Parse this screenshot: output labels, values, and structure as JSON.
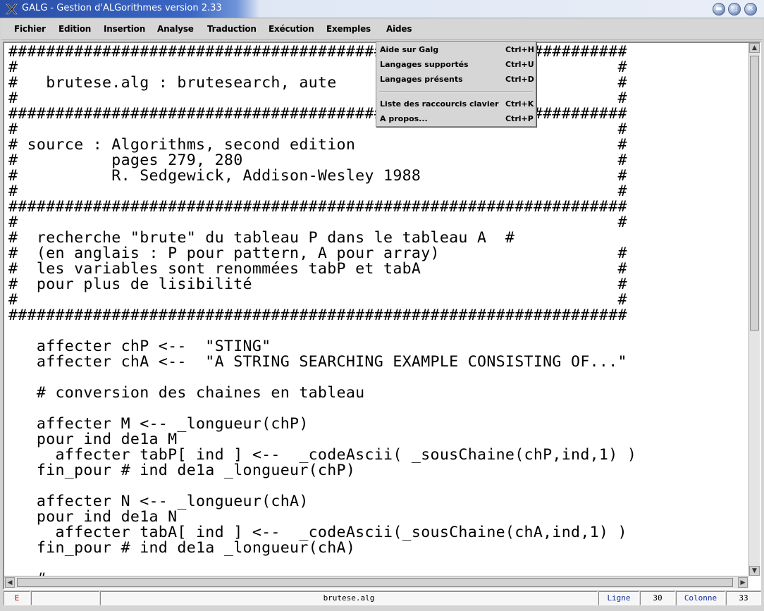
{
  "window": {
    "title": "GALG - Gestion d'ALGorithmes version 2.33",
    "icon": "x-app-icon",
    "buttons": [
      "minimize",
      "maximize",
      "close"
    ]
  },
  "menubar": {
    "items": [
      {
        "label": "Fichier"
      },
      {
        "label": "Edition"
      },
      {
        "label": "Insertion"
      },
      {
        "label": "Analyse"
      },
      {
        "label": "Traduction"
      },
      {
        "label": "Exécution"
      },
      {
        "label": "Exemples"
      },
      {
        "label": "Aides"
      }
    ]
  },
  "dropdown": {
    "menu": "Aides",
    "items": [
      {
        "label": "Aide sur Galg",
        "shortcut": "Ctrl+H"
      },
      {
        "label": "Langages supportés",
        "shortcut": "Ctrl+U"
      },
      {
        "label": "Langages présents",
        "shortcut": "Ctrl+D"
      },
      {
        "label": "Liste des raccourcis clavier",
        "shortcut": "Ctrl+K"
      },
      {
        "label": "A propos...",
        "shortcut": "Ctrl+P"
      }
    ]
  },
  "editor": {
    "lines": [
      "##################################################################",
      "#                                                                #",
      "#   brutese.alg : brutesearch, aute                              #",
      "#                                                                #",
      "##################################################################",
      "#                                                                #",
      "# source : Algorithms, second edition                            #",
      "#          pages 279, 280                                        #",
      "#          R. Sedgewick, Addison-Wesley 1988                     #",
      "#                                                                #",
      "##################################################################",
      "#                                                                #",
      "#  recherche \"brute\" du tableau P dans le tableau A  #",
      "#  (en anglais : P pour pattern, A pour array)                   #",
      "#  les variables sont renommées tabP et tabA                     #",
      "#  pour plus de lisibilité                                       #",
      "#                                                                #",
      "##################################################################",
      "",
      "   affecter chP <--  \"STING\"",
      "   affecter chA <--  \"A STRING SEARCHING EXAMPLE CONSISTING OF...\"",
      "",
      "   # conversion des chaines en tableau",
      "",
      "   affecter M <-- _longueur(chP)",
      "   pour ind de1a M",
      "     affecter tabP[ ind ] <--  _codeAscii( _sousChaine(chP,ind,1) )",
      "   fin_pour # ind de1a _longueur(chP)",
      "",
      "   affecter N <-- _longueur(chA)",
      "   pour ind de1a N",
      "     affecter tabA[ ind ] <--  _codeAscii(_sousChaine(chA,ind,1) )",
      "   fin_pour # ind de1a _longueur(chA)",
      "",
      "   # "
    ]
  },
  "statusbar": {
    "mode": "E",
    "empty": "",
    "filename": "brutese.alg",
    "line_label": "Ligne",
    "line_value": "30",
    "col_label": "Colonne",
    "col_value": "33"
  }
}
